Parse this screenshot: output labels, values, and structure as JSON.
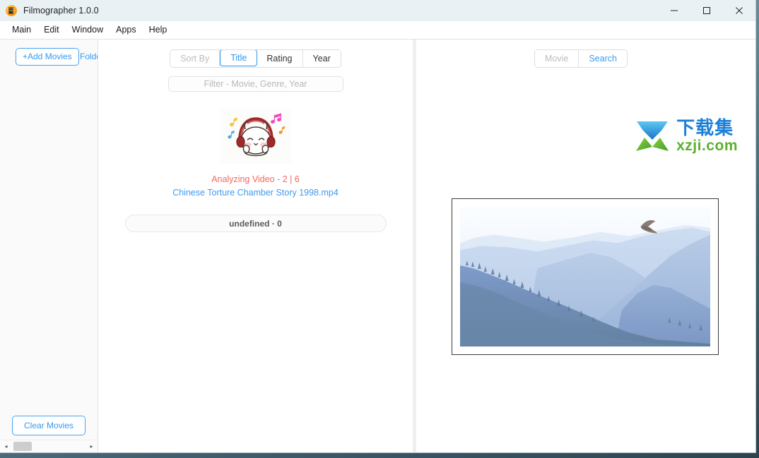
{
  "window": {
    "title": "Filmographer 1.0.0",
    "controls": {
      "minimize": "minimize-icon",
      "maximize": "maximize-icon",
      "close": "close-icon"
    }
  },
  "menubar": {
    "items": [
      {
        "label": "Main"
      },
      {
        "label": "Edit"
      },
      {
        "label": "Window"
      },
      {
        "label": "Apps"
      },
      {
        "label": "Help"
      }
    ]
  },
  "sidebar": {
    "add_movies_label": "+Add Movies",
    "add_folder_label": "Folder",
    "clear_movies_label": "Clear Movies",
    "scrollbar": {
      "left_arrow": "◂",
      "right_arrow": "▸"
    }
  },
  "center": {
    "sort": {
      "label": "Sort By",
      "options": [
        {
          "label": "Title",
          "active": true
        },
        {
          "label": "Rating",
          "active": false
        },
        {
          "label": "Year",
          "active": false
        }
      ]
    },
    "filter": {
      "placeholder": "Filter - Movie, Genre, Year",
      "value": ""
    },
    "artwork_name": "bunny-with-headphones-icon",
    "status_text": "Analyzing Video - 2 | 6",
    "file_name": "Chinese Torture Chamber Story 1998.mp4",
    "progress_text": "undefined · 0"
  },
  "right": {
    "tabs": [
      {
        "label": "Movie",
        "active": false
      },
      {
        "label": "Search",
        "active": true
      }
    ],
    "watermark": {
      "cn": "下载集",
      "en": "xzji.com",
      "logo_name": "download-arrow-logo"
    },
    "photo": {
      "name": "mountain-landscape-with-eagle-photo",
      "alt": "Hazy blue mountain ridges with a soaring eagle"
    }
  },
  "colors": {
    "accent_blue": "#3399f3",
    "active_blue": "#2f97ef",
    "status_red": "#f5675c",
    "link_blue": "#3e9bf0",
    "titlebar_bg": "#eaf1f5",
    "sidebar_bg": "#fafafa",
    "divider": "#efefef",
    "watermark_cn": "#1c7fd6",
    "watermark_en": "#5bb030"
  }
}
